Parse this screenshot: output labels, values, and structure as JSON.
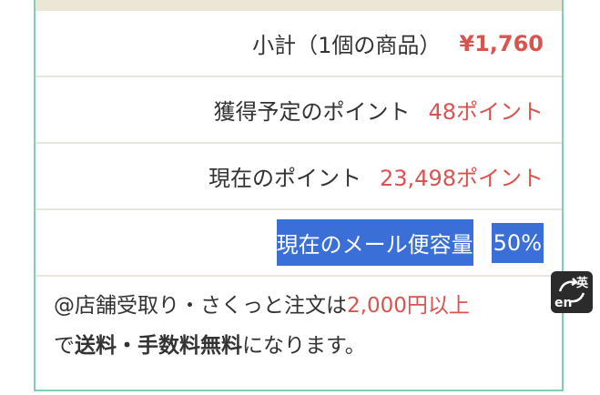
{
  "summary": {
    "subtotal": {
      "label": "小計（1個の商品）",
      "value": "¥1,760"
    },
    "points_to_earn": {
      "label": "獲得予定のポイント",
      "value": "48ポイント"
    },
    "current_points": {
      "label": "現在のポイント",
      "value": "23,498ポイント"
    },
    "mail_capacity": {
      "label": "現在のメール便容量",
      "value": "50%"
    }
  },
  "notice": {
    "part1": "@店舗受取り・さくっと注文は",
    "part2": "2,000円以上",
    "part3": "で",
    "part4": "送料・手数料無料",
    "part5": "になります。"
  },
  "ime_badge": {
    "kanji": "英",
    "latin": "en",
    "icon": "ime-toggle-icon"
  },
  "colors": {
    "accent_red": "#d9534f",
    "highlight_blue": "#3a6fd8",
    "border_green": "#7fcfb0"
  }
}
